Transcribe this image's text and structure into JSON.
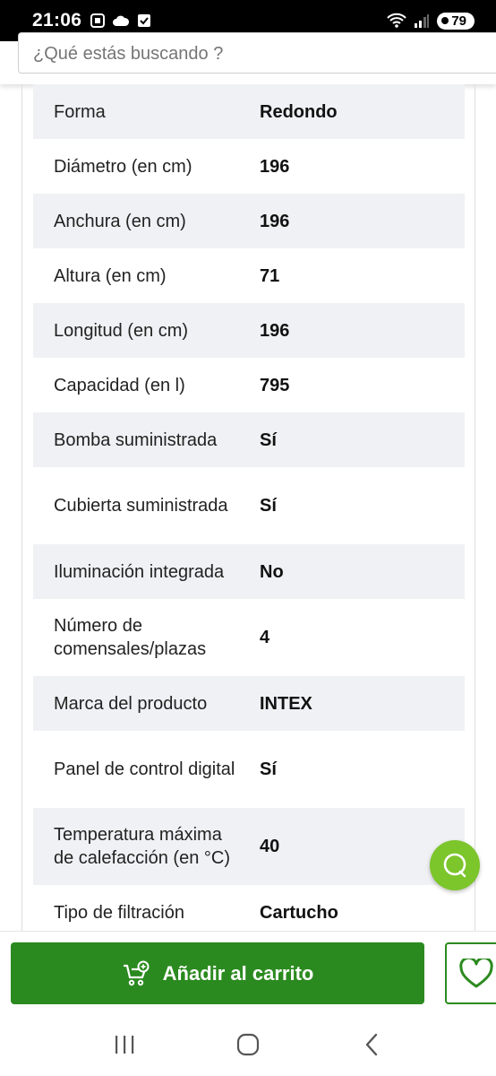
{
  "status_bar": {
    "time": "21:06",
    "battery": "79"
  },
  "search": {
    "placeholder": "¿Qué estás buscando ?"
  },
  "specs": [
    {
      "label": "Forma",
      "value": "Redondo"
    },
    {
      "label": "Diámetro (en cm)",
      "value": "196"
    },
    {
      "label": "Anchura (en cm)",
      "value": "196"
    },
    {
      "label": "Altura (en cm)",
      "value": "71"
    },
    {
      "label": "Longitud (en cm)",
      "value": "196"
    },
    {
      "label": "Capacidad (en l)",
      "value": "795"
    },
    {
      "label": "Bomba suministrada",
      "value": "Sí"
    },
    {
      "label": "Cubierta suministrada",
      "value": "Sí"
    },
    {
      "label": "Iluminación integrada",
      "value": "No"
    },
    {
      "label": "Número de comensales/plazas",
      "value": "4"
    },
    {
      "label": "Marca del producto",
      "value": "INTEX"
    },
    {
      "label": "Panel de control digital",
      "value": "Sí"
    },
    {
      "label": "Temperatura máxima de calefacción (en °C)",
      "value": "40"
    },
    {
      "label": "Tipo de filtración",
      "value": "Cartucho"
    }
  ],
  "actions": {
    "add_to_cart_label": "Añadir al carrito"
  },
  "colors": {
    "primary_green": "#2b8a1f",
    "chat_green": "#7cc52b",
    "row_shade": "#f0f1f4"
  },
  "icons": {
    "cart": "cart-plus-icon",
    "wishlist": "heart-icon",
    "chat": "chat-bubble-icon",
    "nav_recents": "recents-icon",
    "nav_home": "home-icon",
    "nav_back": "back-icon"
  }
}
